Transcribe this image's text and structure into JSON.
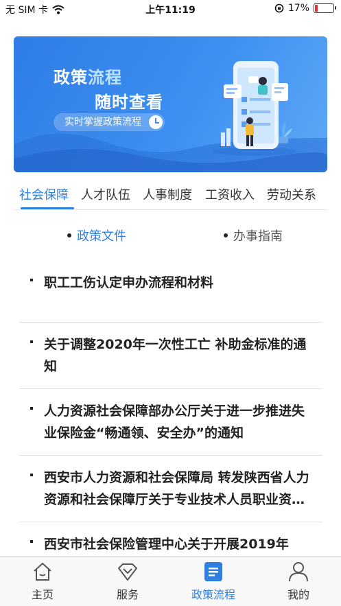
{
  "status_bar": {
    "carrier": "无 SIM 卡",
    "time": "上午11:19",
    "battery_percent": "17%",
    "battery_level": 0.17,
    "battery_color": "#e33333"
  },
  "banner": {
    "title_part1": "政策",
    "title_part2": "流程",
    "title_line2": "随时查看",
    "subtitle": "实时掌握政策流程"
  },
  "tabs": [
    {
      "label": "社会保障",
      "active": true
    },
    {
      "label": "人才队伍",
      "active": false
    },
    {
      "label": "人事制度",
      "active": false
    },
    {
      "label": "工资收入",
      "active": false
    },
    {
      "label": "劳动关系",
      "active": false
    }
  ],
  "sub_tabs": [
    {
      "label": "政策文件",
      "active": true
    },
    {
      "label": "办事指南",
      "active": false
    }
  ],
  "list": [
    {
      "title": "职工工伤认定申办流程和材料"
    },
    {
      "title": "关于调整2020年一次性工亡 补助金标准的通知"
    },
    {
      "title": "人力资源社会保障部办公厅关于进一步推进失业保险金“畅通领、安全办”的通知"
    },
    {
      "title": "西安市人力资源和社会保障局 转发陕西省人力资源和社会保障厅关于专业技术人员职业资格证书"
    },
    {
      "title": "西安市社会保险管理中心关于开展2019年"
    }
  ],
  "bottom_nav": [
    {
      "label": "主页",
      "icon": "home-icon",
      "active": false
    },
    {
      "label": "服务",
      "icon": "diamond-icon",
      "active": false
    },
    {
      "label": "政策流程",
      "icon": "document-icon",
      "active": true
    },
    {
      "label": "我的",
      "icon": "user-icon",
      "active": false
    }
  ],
  "colors": {
    "accent": "#2d7fe0",
    "banner_blue": "#3d8ff0"
  }
}
